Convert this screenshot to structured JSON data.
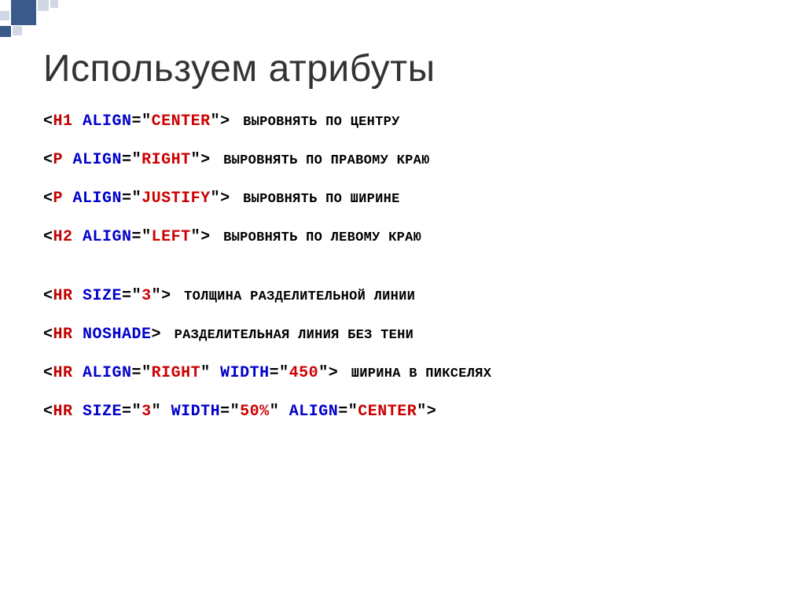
{
  "title": "Используем атрибуты",
  "lines": [
    {
      "parts": [
        {
          "t": "bracket",
          "v": "<"
        },
        {
          "t": "tag",
          "v": "H1 "
        },
        {
          "t": "attr",
          "v": "ALIGN"
        },
        {
          "t": "eq",
          "v": "="
        },
        {
          "t": "quote",
          "v": "\""
        },
        {
          "t": "val",
          "v": "CENTER"
        },
        {
          "t": "quote",
          "v": "\""
        },
        {
          "t": "bracket",
          "v": ">"
        }
      ],
      "desc": "Выровнять по центру"
    },
    {
      "parts": [
        {
          "t": "bracket",
          "v": "<"
        },
        {
          "t": "tag",
          "v": "P "
        },
        {
          "t": "attr",
          "v": "ALIGN"
        },
        {
          "t": "eq",
          "v": "="
        },
        {
          "t": "quote",
          "v": "\""
        },
        {
          "t": "val",
          "v": "RIGHT"
        },
        {
          "t": "quote",
          "v": "\""
        },
        {
          "t": "bracket",
          "v": ">"
        }
      ],
      "desc": "Выровнять по правому краю"
    },
    {
      "parts": [
        {
          "t": "bracket",
          "v": "<"
        },
        {
          "t": "tag",
          "v": "P "
        },
        {
          "t": "attr",
          "v": "ALIGN"
        },
        {
          "t": "eq",
          "v": "="
        },
        {
          "t": "quote",
          "v": "\""
        },
        {
          "t": "val",
          "v": "JUSTIFY"
        },
        {
          "t": "quote",
          "v": "\""
        },
        {
          "t": "bracket",
          "v": ">"
        }
      ],
      "desc": "Выровнять по ширине"
    },
    {
      "parts": [
        {
          "t": "bracket",
          "v": "<"
        },
        {
          "t": "tag",
          "v": "H2 "
        },
        {
          "t": "attr",
          "v": "ALIGN"
        },
        {
          "t": "eq",
          "v": "="
        },
        {
          "t": "quote",
          "v": "\""
        },
        {
          "t": "val",
          "v": "LEFT"
        },
        {
          "t": "quote",
          "v": "\""
        },
        {
          "t": "bracket",
          "v": ">"
        }
      ],
      "desc": "Выровнять по левому краю"
    },
    {
      "gap": true,
      "parts": [
        {
          "t": "bracket",
          "v": "<"
        },
        {
          "t": "tag",
          "v": "HR "
        },
        {
          "t": "attr",
          "v": "SIZE"
        },
        {
          "t": "eq",
          "v": "="
        },
        {
          "t": "quote",
          "v": "\""
        },
        {
          "t": "val",
          "v": "3"
        },
        {
          "t": "quote",
          "v": "\""
        },
        {
          "t": "bracket",
          "v": ">"
        }
      ],
      "desc": "Толщина разделительной линии"
    },
    {
      "parts": [
        {
          "t": "bracket",
          "v": "<"
        },
        {
          "t": "tag",
          "v": "HR "
        },
        {
          "t": "attr",
          "v": "NOSHADE"
        },
        {
          "t": "bracket",
          "v": ">"
        }
      ],
      "desc": "Разделительная линия без тени"
    },
    {
      "parts": [
        {
          "t": "bracket",
          "v": "<"
        },
        {
          "t": "tag",
          "v": "HR "
        },
        {
          "t": "attr",
          "v": "ALIGN"
        },
        {
          "t": "eq",
          "v": "="
        },
        {
          "t": "quote",
          "v": "\""
        },
        {
          "t": "val",
          "v": "RIGHT"
        },
        {
          "t": "quote",
          "v": "\""
        },
        {
          "t": "tag",
          "v": " "
        },
        {
          "t": "attr",
          "v": "WIDTH"
        },
        {
          "t": "eq",
          "v": "="
        },
        {
          "t": "quote",
          "v": "\""
        },
        {
          "t": "val",
          "v": "450"
        },
        {
          "t": "quote",
          "v": "\""
        },
        {
          "t": "bracket",
          "v": ">"
        }
      ],
      "desc": "Ширина в пикселях"
    },
    {
      "parts": [
        {
          "t": "bracket",
          "v": "<"
        },
        {
          "t": "tag",
          "v": "HR "
        },
        {
          "t": "attr",
          "v": "SIZE"
        },
        {
          "t": "eq",
          "v": "="
        },
        {
          "t": "quote",
          "v": "\""
        },
        {
          "t": "val",
          "v": "3"
        },
        {
          "t": "quote",
          "v": "\""
        },
        {
          "t": "tag",
          "v": " "
        },
        {
          "t": "attr",
          "v": "WIDTH"
        },
        {
          "t": "eq",
          "v": "="
        },
        {
          "t": "quote",
          "v": "\""
        },
        {
          "t": "val",
          "v": "50%"
        },
        {
          "t": "quote",
          "v": "\""
        },
        {
          "t": "tag",
          "v": " "
        },
        {
          "t": "attr",
          "v": "ALIGN"
        },
        {
          "t": "eq",
          "v": "="
        },
        {
          "t": "quote",
          "v": "\""
        },
        {
          "t": "val",
          "v": "CENTER"
        },
        {
          "t": "quote",
          "v": "\""
        },
        {
          "t": "bracket",
          "v": ">"
        }
      ],
      "desc": ""
    }
  ]
}
